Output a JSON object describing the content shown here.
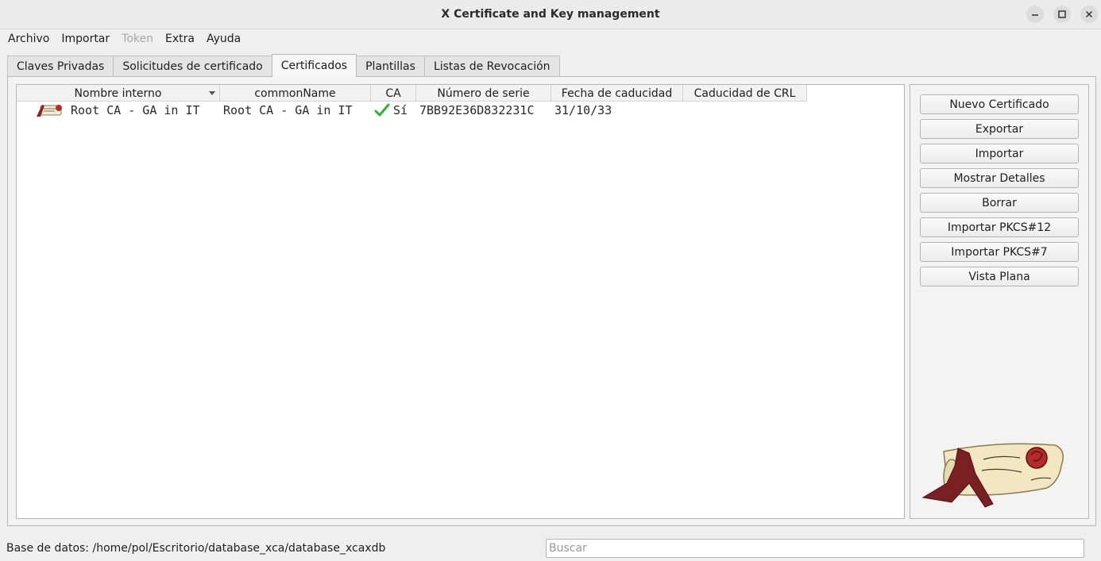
{
  "window": {
    "title": "X Certificate and Key management"
  },
  "menu": [
    {
      "label": "Archivo",
      "enabled": true
    },
    {
      "label": "Importar",
      "enabled": true
    },
    {
      "label": "Token",
      "enabled": false
    },
    {
      "label": "Extra",
      "enabled": true
    },
    {
      "label": "Ayuda",
      "enabled": true
    }
  ],
  "tabs": [
    {
      "label": "Claves Privadas",
      "active": false
    },
    {
      "label": "Solicitudes de certificado",
      "active": false
    },
    {
      "label": "Certificados",
      "active": true
    },
    {
      "label": "Plantillas",
      "active": false
    },
    {
      "label": "Listas de Revocación",
      "active": false
    }
  ],
  "table": {
    "columns": [
      "Nombre interno",
      "commonName",
      "CA",
      "Número de serie",
      "Fecha de caducidad",
      "Caducidad de CRL"
    ],
    "sort_column": "Nombre interno",
    "rows": [
      {
        "icon": "certificate-icon",
        "nombre_interno": "Root CA - GA in IT",
        "common_name": "Root CA - GA in IT",
        "ca": "Sí",
        "ca_icon": "green-checkmark-icon",
        "numero_serie": "7BB92E36D832231C",
        "fecha_caducidad": "31/10/33",
        "caducidad_crl": ""
      }
    ]
  },
  "buttons": [
    "Nuevo Certificado",
    "Exportar",
    "Importar",
    "Mostrar Detalles",
    "Borrar",
    "Importar PKCS#12",
    "Importar PKCS#7",
    "Vista Plana"
  ],
  "status": {
    "database_label": "Base de datos: /home/pol/Escritorio/database_xca/database_xcaxdb",
    "search_placeholder": "Buscar"
  },
  "colors": {
    "check": "#2fb52f",
    "ribbon": "#7a1f22",
    "scroll": "#f2e7c2"
  }
}
